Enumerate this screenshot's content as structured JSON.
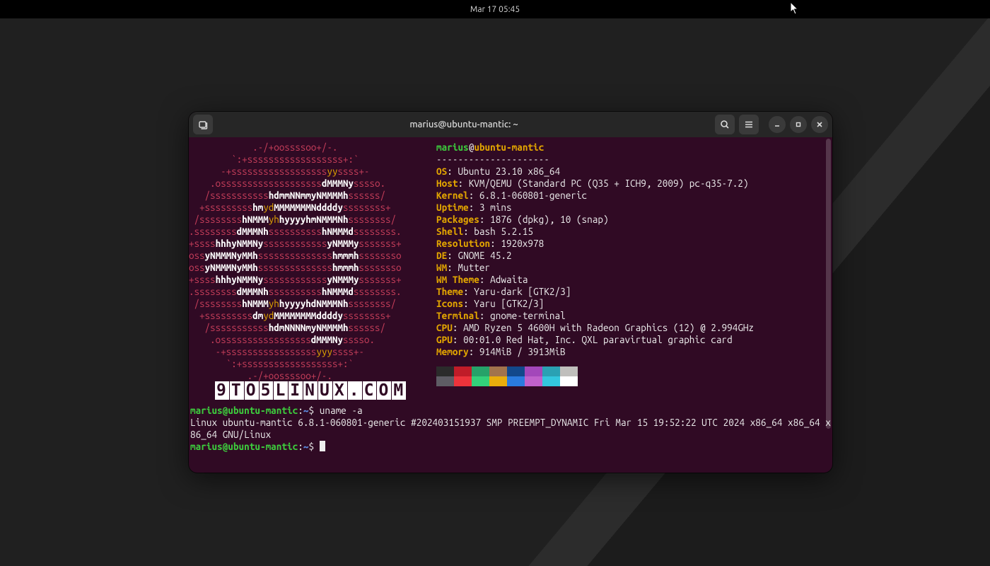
{
  "topbar": {
    "clock": "Mar 17  05:45"
  },
  "window": {
    "title": "marius@ubuntu-mantic: ~"
  },
  "neofetch": {
    "user": "marius",
    "host": "ubuntu-mantic",
    "dash": "---------------------",
    "fields": {
      "os": {
        "label": "OS",
        "value": "Ubuntu 23.10 x86_64"
      },
      "host": {
        "label": "Host",
        "value": "KVM/QEMU (Standard PC (Q35 + ICH9, 2009) pc-q35-7.2)"
      },
      "kernel": {
        "label": "Kernel",
        "value": "6.8.1-060801-generic"
      },
      "uptime": {
        "label": "Uptime",
        "value": "3 mins"
      },
      "packages": {
        "label": "Packages",
        "value": "1876 (dpkg), 10 (snap)"
      },
      "shell": {
        "label": "Shell",
        "value": "bash 5.2.15"
      },
      "resolution": {
        "label": "Resolution",
        "value": "1920x978"
      },
      "de": {
        "label": "DE",
        "value": "GNOME 45.2"
      },
      "wm": {
        "label": "WM",
        "value": "Mutter"
      },
      "wmtheme": {
        "label": "WM Theme",
        "value": "Adwaita"
      },
      "theme": {
        "label": "Theme",
        "value": "Yaru-dark [GTK2/3]"
      },
      "icons": {
        "label": "Icons",
        "value": "Yaru [GTK2/3]"
      },
      "terminal": {
        "label": "Terminal",
        "value": "gnome-terminal"
      },
      "cpu": {
        "label": "CPU",
        "value": "AMD Ryzen 5 4600H with Radeon Graphics (12) @ 2.994GHz"
      },
      "gpu": {
        "label": "GPU",
        "value": "00:01.0 Red Hat, Inc. QXL paravirtual graphic card"
      },
      "memory": {
        "label": "Memory",
        "value": "914MiB / 3913MiB"
      }
    },
    "palette_top": [
      "#2b2b2b",
      "#c01c28",
      "#26a269",
      "#a2734c",
      "#12488b",
      "#a347ba",
      "#2aa1b3",
      "#c0bfbc"
    ],
    "palette_bottom": [
      "#5e5c64",
      "#ed333b",
      "#33d17a",
      "#e9ad0c",
      "#2a7bde",
      "#c061cb",
      "#33c7de",
      "#ffffff"
    ]
  },
  "watermark": "9TO5LINUX.COM",
  "shell": {
    "prompt_user": "marius@ubuntu-mantic",
    "prompt_path": "~",
    "cmd1": "uname -a",
    "out1": "Linux ubuntu-mantic 6.8.1-060801-generic #202403151937 SMP PREEMPT_DYNAMIC Fri Mar 15 19:52:22 UTC 2024 x86_64 x86_64 x86_64 GNU/Linux"
  }
}
